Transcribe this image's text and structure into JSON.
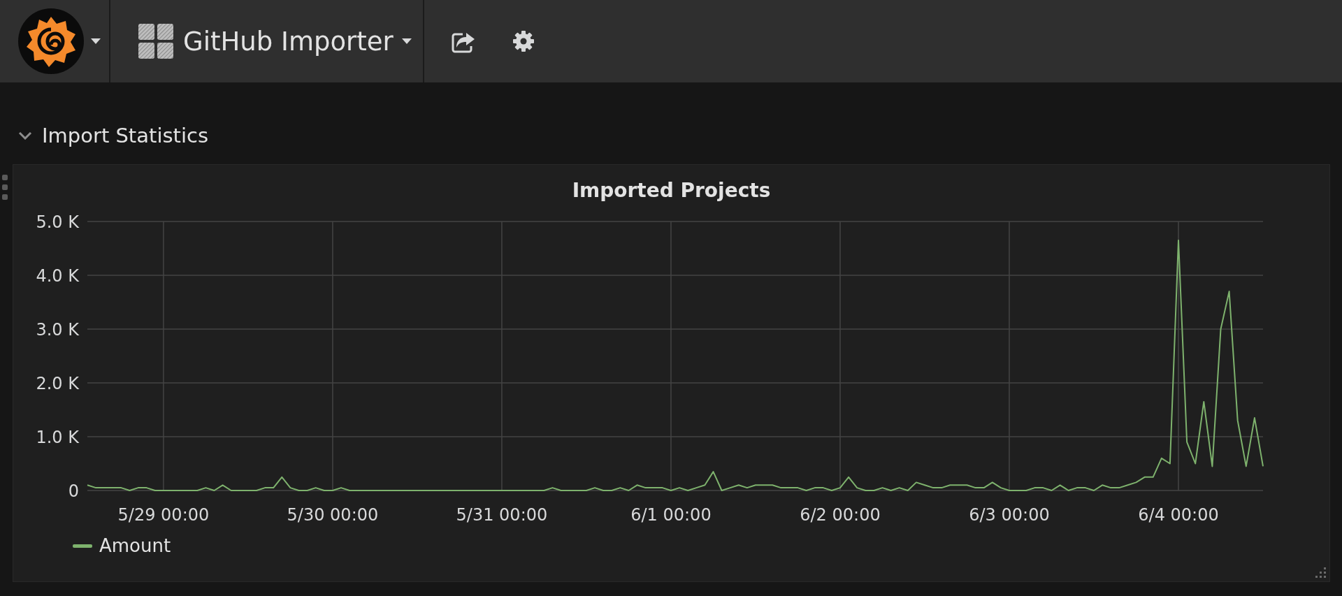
{
  "navbar": {
    "dashboard_title": "GitHub Importer"
  },
  "row": {
    "title": "Import Statistics",
    "expanded": true
  },
  "panel": {
    "chart_data": {
      "type": "line",
      "title": "Imported Projects",
      "categories": [
        null,
        null,
        null,
        null,
        null,
        null,
        null,
        null,
        null,
        "5/29 00:00",
        null,
        null,
        null,
        null,
        null,
        null,
        null,
        null,
        null,
        null,
        null,
        null,
        null,
        null,
        null,
        null,
        null,
        null,
        null,
        "5/30 00:00",
        null,
        null,
        null,
        null,
        null,
        null,
        null,
        null,
        null,
        null,
        null,
        null,
        null,
        null,
        null,
        null,
        null,
        null,
        null,
        "5/31 00:00",
        null,
        null,
        null,
        null,
        null,
        null,
        null,
        null,
        null,
        null,
        null,
        null,
        null,
        null,
        null,
        null,
        null,
        null,
        null,
        "6/1 00:00",
        null,
        null,
        null,
        null,
        null,
        null,
        null,
        null,
        null,
        null,
        null,
        null,
        null,
        null,
        null,
        null,
        null,
        null,
        null,
        "6/2 00:00",
        null,
        null,
        null,
        null,
        null,
        null,
        null,
        null,
        null,
        null,
        null,
        null,
        null,
        null,
        null,
        null,
        null,
        null,
        null,
        "6/3 00:00",
        null,
        null,
        null,
        null,
        null,
        null,
        null,
        null,
        null,
        null,
        null,
        null,
        null,
        null,
        null,
        null,
        null,
        null,
        null,
        "6/4 00:00",
        null,
        null,
        null,
        null,
        null,
        null,
        null,
        null,
        null,
        null
      ],
      "series": [
        {
          "name": "Amount",
          "color": "#7eb26d",
          "values": [
            100,
            50,
            50,
            50,
            50,
            0,
            50,
            50,
            0,
            0,
            0,
            0,
            0,
            0,
            50,
            0,
            100,
            0,
            0,
            0,
            0,
            50,
            50,
            250,
            50,
            0,
            0,
            50,
            0,
            0,
            50,
            0,
            0,
            0,
            0,
            0,
            0,
            0,
            0,
            0,
            0,
            0,
            0,
            0,
            0,
            0,
            0,
            0,
            0,
            0,
            0,
            0,
            0,
            0,
            0,
            50,
            0,
            0,
            0,
            0,
            50,
            0,
            0,
            50,
            0,
            100,
            50,
            50,
            50,
            0,
            50,
            0,
            50,
            100,
            350,
            0,
            50,
            100,
            50,
            100,
            100,
            100,
            50,
            50,
            50,
            0,
            50,
            50,
            0,
            50,
            250,
            50,
            0,
            0,
            50,
            0,
            50,
            0,
            150,
            100,
            50,
            50,
            100,
            100,
            100,
            50,
            50,
            150,
            50,
            0,
            0,
            0,
            50,
            50,
            0,
            100,
            0,
            50,
            50,
            0,
            100,
            50,
            50,
            100,
            150,
            250,
            250,
            600,
            500,
            4650,
            900,
            500,
            1650,
            450,
            3000,
            3700,
            1300,
            450,
            1350,
            450
          ]
        }
      ],
      "grid": true,
      "ylim": [
        0,
        5000
      ],
      "yticks": [
        {
          "value": 0,
          "label": "0"
        },
        {
          "value": 1000,
          "label": "1.0 K"
        },
        {
          "value": 2000,
          "label": "2.0 K"
        },
        {
          "value": 3000,
          "label": "3.0 K"
        },
        {
          "value": 4000,
          "label": "4.0 K"
        },
        {
          "value": 5000,
          "label": "5.0 K"
        }
      ]
    }
  }
}
